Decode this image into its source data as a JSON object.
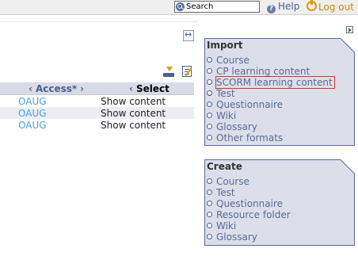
{
  "topbar": {
    "search_value": "Search",
    "help_label": "Help",
    "logout_label": "Log out"
  },
  "table": {
    "headers": {
      "access": "Access*",
      "select": "Select"
    },
    "rows": [
      {
        "access": "OAUG",
        "action": "Show content"
      },
      {
        "access": "OAUG",
        "action": "Show content"
      },
      {
        "access": "OAUG",
        "action": "Show content"
      }
    ]
  },
  "import_box": {
    "title": "Import",
    "items": [
      "Course",
      "CP learning content",
      "SCORM learning content",
      "Test",
      "Questionnaire",
      "Wiki",
      "Glossary",
      "Other formats"
    ],
    "highlighted_item": "SCORM learning content"
  },
  "create_box": {
    "title": "Create",
    "items": [
      "Course",
      "Test",
      "Questionnaire",
      "Resource folder",
      "Wiki",
      "Glossary"
    ]
  },
  "colors": {
    "box_fill": "#dcdfea",
    "box_border": "#5a6898",
    "link": "#5b6a98",
    "access_link": "#4aa0e0",
    "highlight_outline": "#e0302a",
    "logout": "#d08a00"
  }
}
